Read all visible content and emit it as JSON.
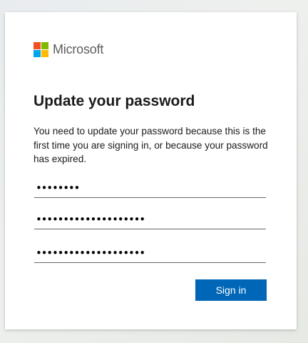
{
  "brand": {
    "name": "Microsoft",
    "logo_colors": [
      "#f25022",
      "#7fba00",
      "#00a4ef",
      "#ffb900"
    ]
  },
  "form": {
    "title": "Update your password",
    "description": "You need to update your password because this is the first time you are signing in, or because your password has expired.",
    "current_password_mask": "••••••••",
    "new_password_mask": "••••••••••••••••••••",
    "confirm_password_mask": "••••••••••••••••••••",
    "submit_label": "Sign in",
    "accent_color": "#0067b8"
  }
}
